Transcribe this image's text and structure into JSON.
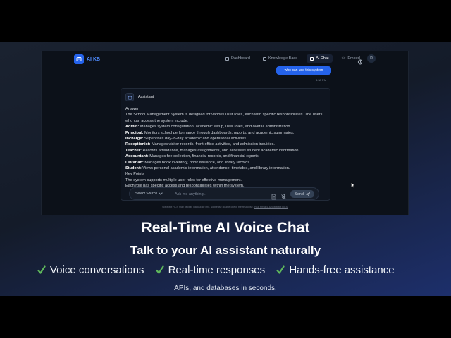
{
  "app": {
    "logo_text": "AI KB",
    "nav": [
      {
        "label": "Dashboard",
        "active": false
      },
      {
        "label": "Knowledge Base",
        "active": false
      },
      {
        "label": "AI Chat",
        "active": true
      },
      {
        "label": "Embed",
        "active": false
      }
    ],
    "user_initial": "R",
    "theme_icon": "moon-icon"
  },
  "chat": {
    "user_message": "who can use this system",
    "user_time": "4:38 PM",
    "assistant_name": "Assistant",
    "answer_heading": "Answer",
    "answer_intro": "The School Management System is designed for various user roles, each with specific responsibilities. The users who can access the system include:",
    "roles": [
      {
        "role": "Admin:",
        "desc": " Manages system configuration, academic setup, user roles, and overall administration."
      },
      {
        "role": "Principal:",
        "desc": " Monitors school performance through dashboards, reports, and academic summaries."
      },
      {
        "role": "Incharge:",
        "desc": " Supervises day-to-day academic and operational activities."
      },
      {
        "role": "Receptionist:",
        "desc": " Manages visitor records, front-office activities, and admission inquiries."
      },
      {
        "role": "Teacher:",
        "desc": " Records attendance, manages assignments, and accesses student academic information."
      },
      {
        "role": "Accountant:",
        "desc": " Manages fee collection, financial records, and financial reports."
      },
      {
        "role": "Librarian:",
        "desc": " Manages book inventory, book issuance, and library records."
      },
      {
        "role": "Student:",
        "desc": " Views personal academic information, attendance, timetable, and library information."
      }
    ],
    "key_points_heading": "Key Points",
    "key_point_1": "The system supports multiple user roles for effective management.",
    "key_point_2": "Each role has specific access and responsibilities within the system."
  },
  "composer": {
    "source_label": "Select Source",
    "placeholder": "Ask me anything...",
    "send_label": "Send"
  },
  "disclaimer": {
    "text": "SMMMM RCS may display inaccurate info, so please double check the response. ",
    "link": "Your Privacy & SMMMM RCS"
  },
  "overlay": {
    "headline": "Real-Time AI Voice Chat",
    "subhead": "Talk to your AI assistant naturally",
    "features": [
      "Voice conversations",
      "Real-time responses",
      "Hands-free assistance"
    ],
    "tagline": "APIs, and databases in seconds."
  },
  "colors": {
    "accent": "#2563eb",
    "check": "#5fb85c"
  }
}
